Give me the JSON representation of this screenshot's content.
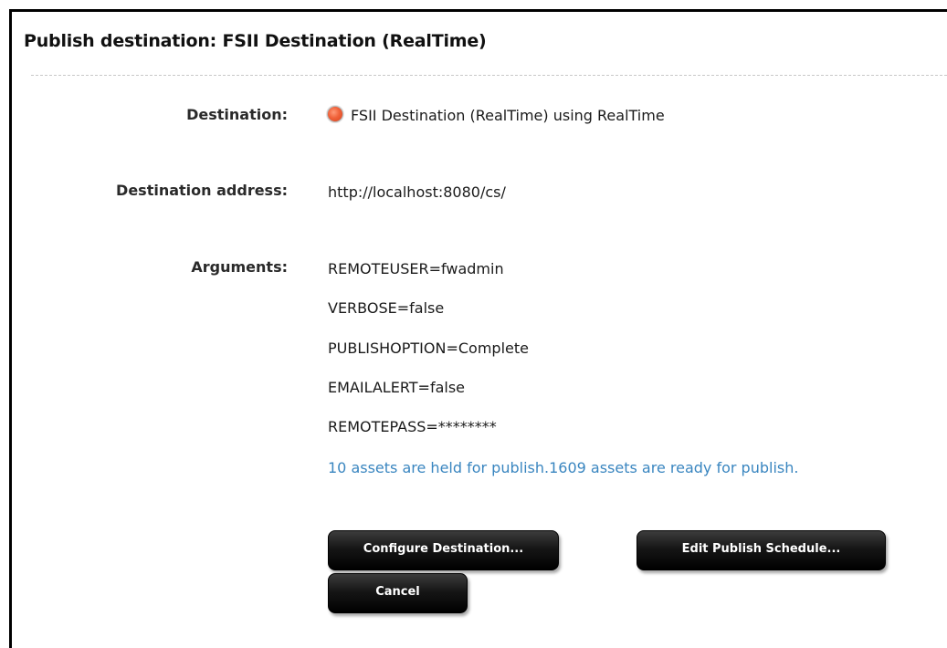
{
  "page": {
    "title": "Publish destination: FSII Destination (RealTime)"
  },
  "fields": {
    "destination_label": "Destination:",
    "destination_value": "FSII Destination (RealTime) using RealTime",
    "destination_status_color": "#f0623a",
    "address_label": "Destination address:",
    "address_value": "http://localhost:8080/cs/",
    "arguments_label": "Arguments:",
    "arguments": [
      "REMOTEUSER=fwadmin",
      "VERBOSE=false",
      "PUBLISHOPTION=Complete",
      "EMAILALERT=false",
      "REMOTEPASS=********"
    ],
    "publish_info": "10 assets are held for publish.1609 assets are ready for publish."
  },
  "buttons": {
    "configure": "Configure Destination...",
    "edit_schedule": "Edit Publish Schedule...",
    "cancel": "Cancel"
  },
  "colors": {
    "info_text": "#3a86c0",
    "button_bg": "#111111"
  }
}
